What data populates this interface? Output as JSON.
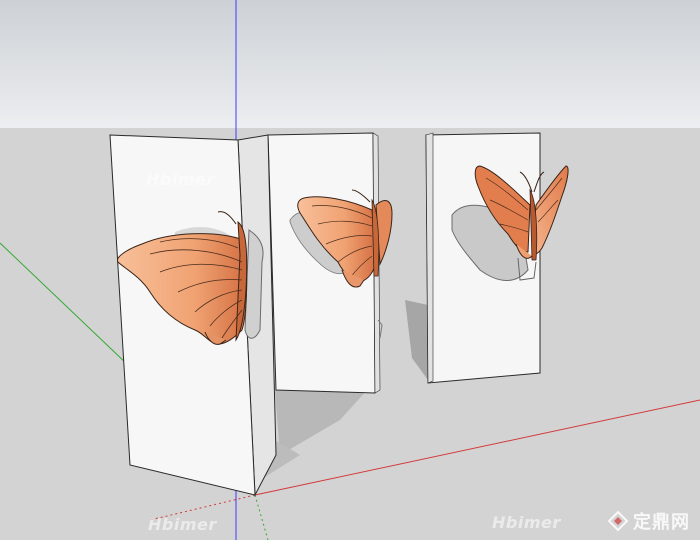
{
  "app": {
    "type": "3d-modeling-viewport"
  },
  "scene": {
    "sky_colors": [
      "#cfd3d8",
      "#e9ebee"
    ],
    "ground_color": "#d3d3d3",
    "panel_color": "#f7f7f7",
    "panel_edge_color": "#2a2a2a",
    "shadow_color": "#a4a4a4",
    "wing_colors": [
      "#f6b48c",
      "#e48656",
      "#c9663a"
    ],
    "axes": {
      "blue": "#3030ff",
      "red": "#d23a3a",
      "green": "#38a838"
    }
  },
  "watermarks": {
    "panel_top": "Hbimer",
    "bottom_left": "Hbimer",
    "bottom_right": "Hbimer"
  },
  "brand": {
    "text": "定鼎网"
  }
}
